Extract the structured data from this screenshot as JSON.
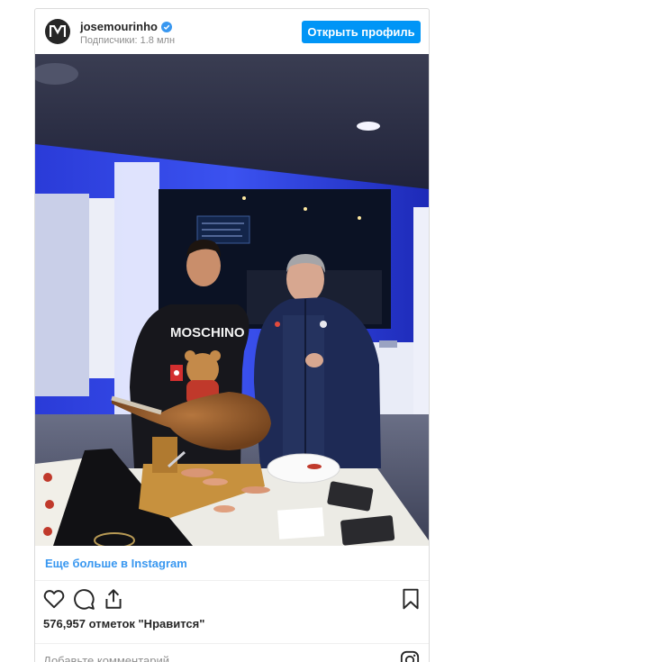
{
  "post": {
    "username": "josemourinho",
    "followers": "Подписчики: 1.8 млн",
    "open_profile_label": "Открыть профиль",
    "more_link": "Еще больше в Instagram",
    "likes": "576,957 отметок \"Нравится\"",
    "comment_placeholder": "Добавьте комментарий...",
    "accent_color": "#0095f6",
    "link_color": "#3897f0"
  },
  "photo": {
    "jumper_text": "MOSCHINO"
  },
  "icons": {
    "avatar": "mourinho-logo-icon",
    "verified": "verified-badge-icon",
    "like": "heart-icon",
    "comment": "comment-icon",
    "share": "share-icon",
    "save": "bookmark-icon",
    "instagram": "instagram-icon"
  }
}
